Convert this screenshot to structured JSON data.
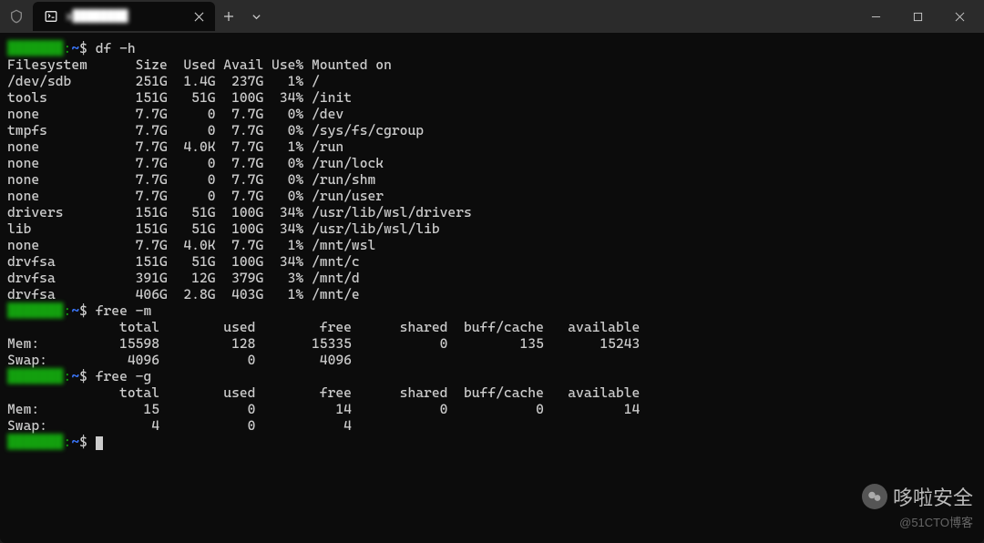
{
  "window": {
    "tab_title": "x████████",
    "min_label": "minimize",
    "max_label": "maximize",
    "close_label": "close"
  },
  "prompts": {
    "user": "███████",
    "host_suffix": ":",
    "path": "~",
    "dollar": "$"
  },
  "commands": {
    "df": "df -h",
    "freem": "free -m",
    "freeg": "free -g"
  },
  "df_header": "Filesystem      Size  Used Avail Use% Mounted on",
  "df_rows": [
    "/dev/sdb        251G  1.4G  237G   1% /",
    "tools           151G   51G  100G  34% /init",
    "none            7.7G     0  7.7G   0% /dev",
    "tmpfs           7.7G     0  7.7G   0% /sys/fs/cgroup",
    "none            7.7G  4.0K  7.7G   1% /run",
    "none            7.7G     0  7.7G   0% /run/lock",
    "none            7.7G     0  7.7G   0% /run/shm",
    "none            7.7G     0  7.7G   0% /run/user",
    "drivers         151G   51G  100G  34% /usr/lib/wsl/drivers",
    "lib             151G   51G  100G  34% /usr/lib/wsl/lib",
    "none            7.7G  4.0K  7.7G   1% /mnt/wsl",
    "drvfsa          151G   51G  100G  34% /mnt/c",
    "drvfsa          391G   12G  379G   3% /mnt/d",
    "drvfsa          406G  2.8G  403G   1% /mnt/e"
  ],
  "free_header": "              total        used        free      shared  buff/cache   available",
  "free_m_rows": [
    "Mem:          15598         128       15335           0         135       15243",
    "Swap:          4096           0        4096"
  ],
  "free_g_rows": [
    "Mem:             15           0          14           0           0          14",
    "Swap:             4           0           4"
  ],
  "chart_data": {
    "type": "table",
    "df": {
      "columns": [
        "Filesystem",
        "Size",
        "Used",
        "Avail",
        "Use%",
        "Mounted on"
      ],
      "rows": [
        [
          "/dev/sdb",
          "251G",
          "1.4G",
          "237G",
          "1%",
          "/"
        ],
        [
          "tools",
          "151G",
          "51G",
          "100G",
          "34%",
          "/init"
        ],
        [
          "none",
          "7.7G",
          "0",
          "7.7G",
          "0%",
          "/dev"
        ],
        [
          "tmpfs",
          "7.7G",
          "0",
          "7.7G",
          "0%",
          "/sys/fs/cgroup"
        ],
        [
          "none",
          "7.7G",
          "4.0K",
          "7.7G",
          "1%",
          "/run"
        ],
        [
          "none",
          "7.7G",
          "0",
          "7.7G",
          "0%",
          "/run/lock"
        ],
        [
          "none",
          "7.7G",
          "0",
          "7.7G",
          "0%",
          "/run/shm"
        ],
        [
          "none",
          "7.7G",
          "0",
          "7.7G",
          "0%",
          "/run/user"
        ],
        [
          "drivers",
          "151G",
          "51G",
          "100G",
          "34%",
          "/usr/lib/wsl/drivers"
        ],
        [
          "lib",
          "151G",
          "51G",
          "100G",
          "34%",
          "/usr/lib/wsl/lib"
        ],
        [
          "none",
          "7.7G",
          "4.0K",
          "7.7G",
          "1%",
          "/mnt/wsl"
        ],
        [
          "drvfsa",
          "151G",
          "51G",
          "100G",
          "34%",
          "/mnt/c"
        ],
        [
          "drvfsa",
          "391G",
          "12G",
          "379G",
          "3%",
          "/mnt/d"
        ],
        [
          "drvfsa",
          "406G",
          "2.8G",
          "403G",
          "1%",
          "/mnt/e"
        ]
      ]
    },
    "free_m": {
      "columns": [
        "",
        "total",
        "used",
        "free",
        "shared",
        "buff/cache",
        "available"
      ],
      "rows": [
        [
          "Mem:",
          15598,
          128,
          15335,
          0,
          135,
          15243
        ],
        [
          "Swap:",
          4096,
          0,
          4096,
          null,
          null,
          null
        ]
      ]
    },
    "free_g": {
      "columns": [
        "",
        "total",
        "used",
        "free",
        "shared",
        "buff/cache",
        "available"
      ],
      "rows": [
        [
          "Mem:",
          15,
          0,
          14,
          0,
          0,
          14
        ],
        [
          "Swap:",
          4,
          0,
          4,
          null,
          null,
          null
        ]
      ]
    }
  },
  "watermark": {
    "main": "哆啦安全",
    "sub": "@51CTO博客"
  }
}
